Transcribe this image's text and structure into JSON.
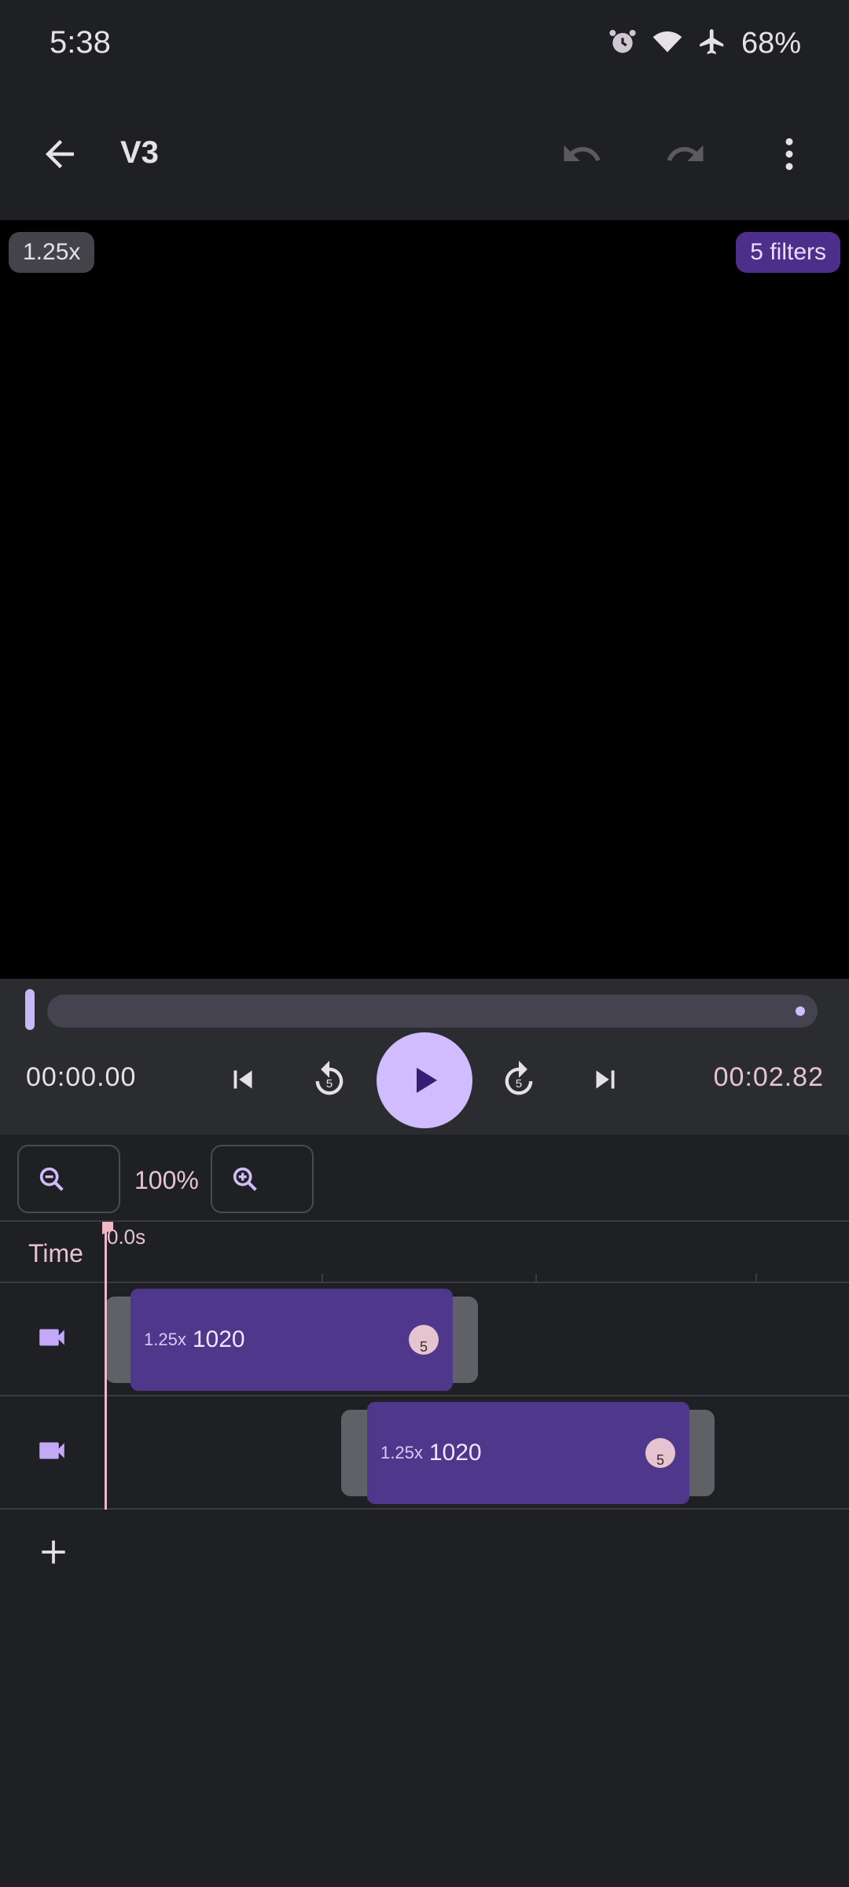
{
  "status_bar": {
    "time": "5:38",
    "battery": "68%",
    "icons": [
      "alarm-icon",
      "wifi-icon",
      "airplane-icon"
    ]
  },
  "app_bar": {
    "title": "V3",
    "icons": [
      "back-arrow-icon",
      "undo-icon",
      "redo-icon",
      "more-vert-icon"
    ]
  },
  "preview": {
    "speed_chip": "1.25x",
    "filters_chip": "5 filters"
  },
  "playback": {
    "current_time": "00:00.00",
    "total_time": "00:02.82",
    "progress": 0.0,
    "rewind_seconds": "5",
    "forward_seconds": "5"
  },
  "zoom": {
    "level": "100%"
  },
  "timeline": {
    "time_label": "Time",
    "start_marker": "0.0s",
    "tracks": [
      {
        "speed": "1.25x",
        "name": "1020",
        "badge": "5"
      },
      {
        "speed": "1.25x",
        "name": "1020",
        "badge": "5"
      }
    ]
  },
  "colors": {
    "background": "#1f2024",
    "accent": "#d0bcff",
    "clip": "#4f378b",
    "playhead": "#f2b8c6"
  }
}
